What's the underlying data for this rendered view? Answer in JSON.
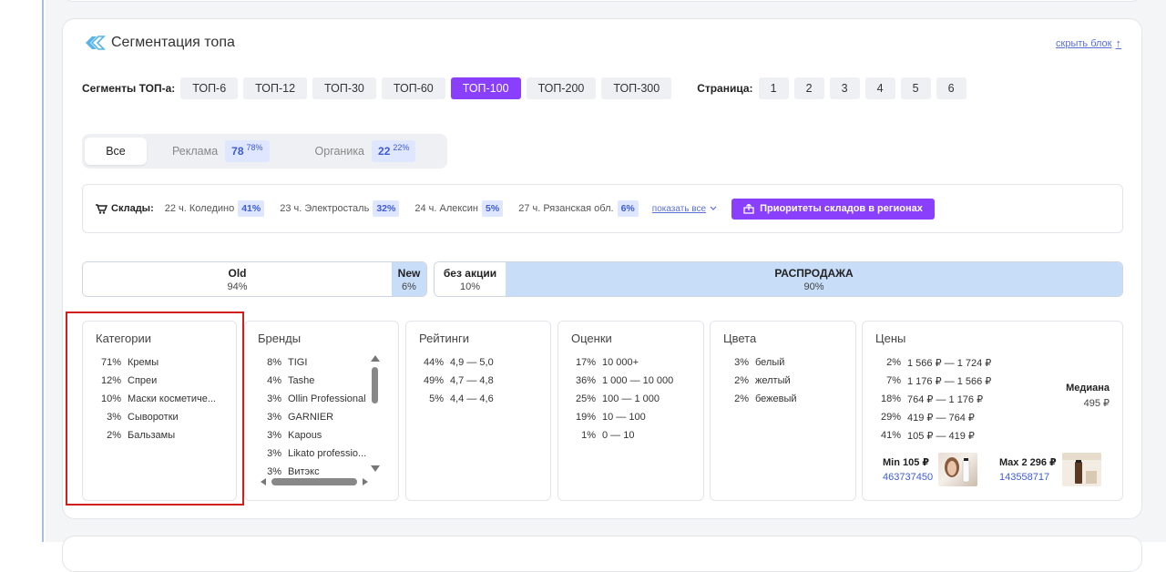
{
  "header": {
    "title": "Сегментация топа",
    "hide_link": "скрыть блок"
  },
  "segments": {
    "label": "Сегменты ТОП-а:",
    "items": [
      "ТОП-6",
      "ТОП-12",
      "ТОП-30",
      "ТОП-60",
      "ТОП-100",
      "ТОП-200",
      "ТОП-300"
    ],
    "active": "ТОП-100",
    "page_label": "Страница:",
    "pages": [
      "1",
      "2",
      "3",
      "4",
      "5",
      "6"
    ]
  },
  "filter_tabs": {
    "all": "Все",
    "ads": {
      "label": "Реклама",
      "count": "78",
      "pct": "78%"
    },
    "organic": {
      "label": "Органика",
      "count": "22",
      "pct": "22%"
    }
  },
  "warehouses": {
    "label": "Склады:",
    "items": [
      {
        "name": "22 ч. Коледино",
        "pct": "41%"
      },
      {
        "name": "23 ч. Электросталь",
        "pct": "32%"
      },
      {
        "name": "24 ч. Алексин",
        "pct": "5%"
      },
      {
        "name": "27 ч. Рязанская обл.",
        "pct": "6%"
      }
    ],
    "show_all": "показать все",
    "priority_button": "Приоритеты складов в регионах"
  },
  "age_bar": {
    "old": {
      "label": "Old",
      "value": "94%",
      "share": 94
    },
    "new": {
      "label": "New",
      "value": "6%",
      "share": 6
    }
  },
  "promo_bar": {
    "none": {
      "label": "без акции",
      "value": "10%",
      "share": 10
    },
    "sale": {
      "label": "РАСПРОДАЖА",
      "value": "90%",
      "share": 90
    }
  },
  "columns": {
    "categories": {
      "title": "Категории",
      "rows": [
        {
          "pct": "71%",
          "name": "Кремы"
        },
        {
          "pct": "12%",
          "name": "Спреи"
        },
        {
          "pct": "10%",
          "name": "Маски косметиче..."
        },
        {
          "pct": "3%",
          "name": "Сыворотки"
        },
        {
          "pct": "2%",
          "name": "Бальзамы"
        }
      ]
    },
    "brands": {
      "title": "Бренды",
      "rows": [
        {
          "pct": "8%",
          "name": "TIGI"
        },
        {
          "pct": "4%",
          "name": "Tashe"
        },
        {
          "pct": "3%",
          "name": "Ollin Professional"
        },
        {
          "pct": "3%",
          "name": "GARNIER"
        },
        {
          "pct": "3%",
          "name": "Kapous"
        },
        {
          "pct": "3%",
          "name": "Likato professio..."
        },
        {
          "pct": "3%",
          "name": "Витэкс"
        }
      ]
    },
    "ratings": {
      "title": "Рейтинги",
      "rows": [
        {
          "pct": "44%",
          "name": "4,9 — 5,0"
        },
        {
          "pct": "49%",
          "name": "4,7 — 4,8"
        },
        {
          "pct": "5%",
          "name": "4,4 — 4,6"
        }
      ]
    },
    "reviews": {
      "title": "Оценки",
      "rows": [
        {
          "pct": "17%",
          "name": "10 000+"
        },
        {
          "pct": "36%",
          "name": "1 000 — 10 000"
        },
        {
          "pct": "25%",
          "name": "100 — 1 000"
        },
        {
          "pct": "19%",
          "name": "10 — 100"
        },
        {
          "pct": "1%",
          "name": "0 — 10"
        }
      ]
    },
    "colors": {
      "title": "Цвета",
      "rows": [
        {
          "pct": "3%",
          "name": "белый"
        },
        {
          "pct": "2%",
          "name": "желтый"
        },
        {
          "pct": "2%",
          "name": "бежевый"
        }
      ]
    },
    "prices": {
      "title": "Цены",
      "rows": [
        {
          "pct": "2%",
          "name": "1 566 ₽ — 1 724 ₽"
        },
        {
          "pct": "7%",
          "name": "1 176 ₽ — 1 566 ₽"
        },
        {
          "pct": "18%",
          "name": "764 ₽ — 1 176 ₽"
        },
        {
          "pct": "29%",
          "name": "419 ₽ — 764 ₽"
        },
        {
          "pct": "41%",
          "name": "105 ₽ — 419 ₽"
        }
      ],
      "median_label": "Медиана",
      "median_value": "495 ₽",
      "min_label": "Min 105 ₽",
      "min_sku": "463737450",
      "max_label": "Max 2 296 ₽",
      "max_sku": "143558717"
    }
  },
  "colors": {
    "accent": "#8a3ffc",
    "badge_bg": "#dfe6ff",
    "badge_text": "#3f5bd6",
    "highlight": "#d11f1f",
    "bar_blue": "#c8ddf8"
  }
}
